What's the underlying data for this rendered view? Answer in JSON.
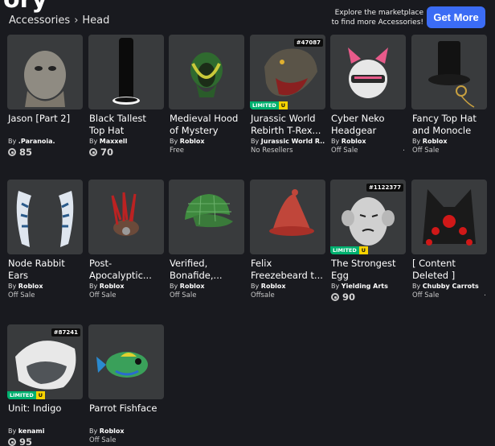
{
  "header": {
    "title": "ory",
    "breadcrumb": [
      "Accessories",
      "Head"
    ],
    "promo_line1": "Explore the marketplace",
    "promo_line2": "to find more Accessories!",
    "get_more_label": "Get More"
  },
  "items": [
    {
      "name": "Jason [Part 2]",
      "by": "By",
      "creator": ".Paranoia.",
      "price": "85",
      "price_type": "robux",
      "thumb_color": "#8f8b82"
    },
    {
      "name": "Black Tallest Top Hat",
      "by": "By",
      "creator": "Maxxell",
      "price": "70",
      "price_type": "robux",
      "thumb_color": "#0b0b0b"
    },
    {
      "name": "Medieval Hood of Mystery",
      "by": "By",
      "creator": "Roblox",
      "price": "Free",
      "price_type": "text",
      "thumb_color": "#2f6a2f"
    },
    {
      "name": "Jurassic World Rebirth T-Rex...",
      "by": "By",
      "creator": "Jurassic World R...",
      "price": "No Resellers",
      "price_type": "text",
      "serial": "#47087",
      "limited": true,
      "thumb_color": "#5a5448"
    },
    {
      "name": "Cyber Neko Headgear",
      "by": "By",
      "creator": "Roblox",
      "price": "Off Sale",
      "price_type": "text",
      "dot": ".",
      "thumb_color": "#e7e7e7"
    },
    {
      "name": "Fancy Top Hat and Monocle",
      "by": "By",
      "creator": "Roblox",
      "price": "Off Sale",
      "price_type": "text",
      "thumb_color": "#121212"
    },
    {
      "name": "Node Rabbit Ears",
      "by": "By",
      "creator": "Roblox",
      "price": "Off Sale",
      "price_type": "text",
      "thumb_color": "#dfe6ef"
    },
    {
      "name": "Post-Apocalyptic...",
      "by": "By",
      "creator": "Roblox",
      "price": "Off Sale",
      "price_type": "text",
      "thumb_color": "#6b4a3a"
    },
    {
      "name": "Verified, Bonafide,...",
      "by": "By",
      "creator": "Roblox",
      "price": "Off Sale",
      "price_type": "text",
      "thumb_color": "#3f8a3f"
    },
    {
      "name": "Felix Freezebeard t...",
      "by": "By",
      "creator": "Roblox",
      "price": "Offsale",
      "price_type": "text",
      "thumb_color": "#c0463a"
    },
    {
      "name": "The Strongest Egg",
      "by": "By",
      "creator": "Yielding Arts",
      "price": "90",
      "price_type": "robux",
      "serial": "#1122377",
      "limited": true,
      "thumb_color": "#d0d0d0"
    },
    {
      "name": "[ Content Deleted ]",
      "by": "By",
      "creator": "Chubby Carrots",
      "price": "Off Sale",
      "price_type": "text",
      "dot": ".",
      "thumb_color": "#1a1a1a"
    },
    {
      "name": "Unit: Indigo",
      "by": "By",
      "creator": "kenami",
      "price": "95",
      "price_type": "robux",
      "serial": "#87241",
      "limited": true,
      "thumb_color": "#e8e8e8"
    },
    {
      "name": "Parrot Fishface",
      "by": "By",
      "creator": "Roblox",
      "price": "Off Sale",
      "price_type": "text",
      "thumb_color": "#3aa05a"
    }
  ],
  "limited_label": "LIMITED",
  "limited_u": "U"
}
